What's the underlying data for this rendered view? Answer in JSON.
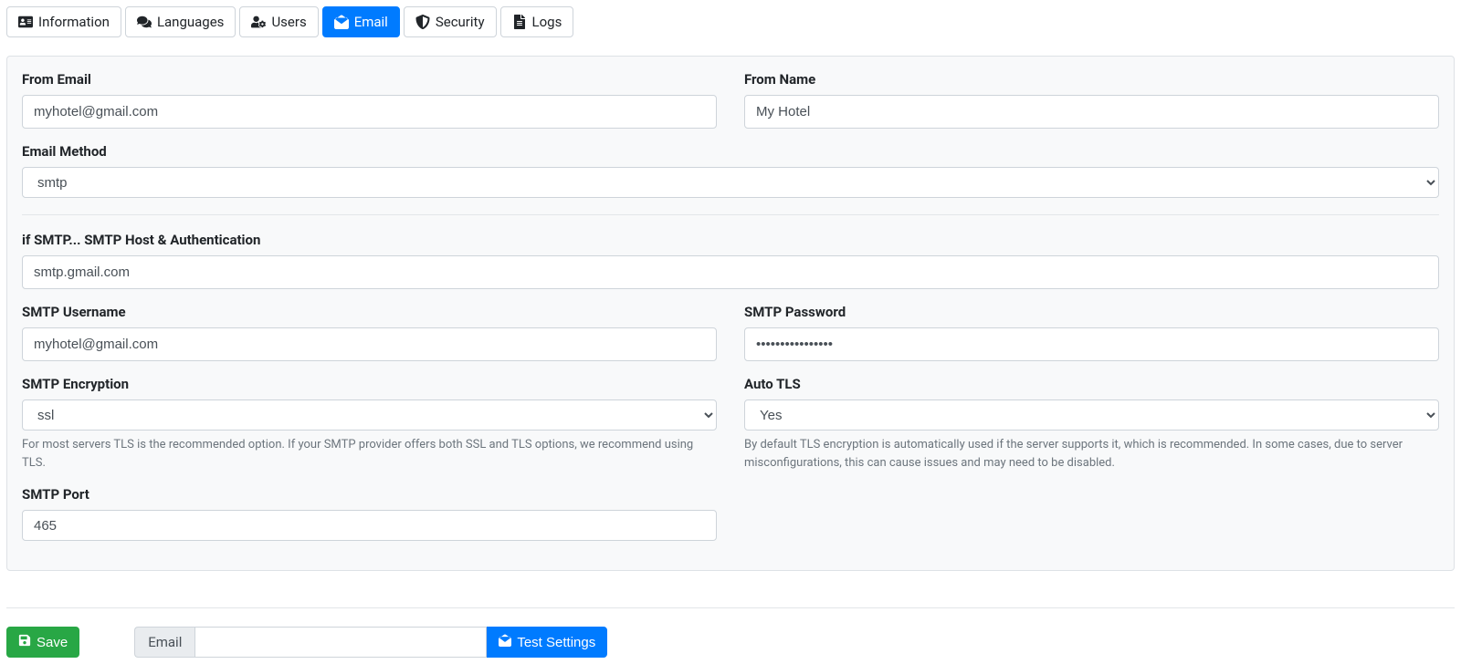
{
  "tabs": [
    {
      "name": "information",
      "label": "Information",
      "icon": "id-card-icon"
    },
    {
      "name": "languages",
      "label": "Languages",
      "icon": "comments-icon"
    },
    {
      "name": "users",
      "label": "Users",
      "icon": "user-gear-icon"
    },
    {
      "name": "email",
      "label": "Email",
      "icon": "envelope-open-icon",
      "active": true
    },
    {
      "name": "security",
      "label": "Security",
      "icon": "shield-icon"
    },
    {
      "name": "logs",
      "label": "Logs",
      "icon": "file-icon"
    }
  ],
  "form": {
    "from_email": {
      "label": "From Email",
      "value": "myhotel@gmail.com"
    },
    "from_name": {
      "label": "From Name",
      "value": "My Hotel"
    },
    "email_method": {
      "label": "Email Method",
      "value": "smtp"
    },
    "smtp_host": {
      "label": "if SMTP... SMTP Host & Authentication",
      "value": "smtp.gmail.com"
    },
    "smtp_user": {
      "label": "SMTP Username",
      "value": "myhotel@gmail.com"
    },
    "smtp_pass": {
      "label": "SMTP Password",
      "value": "••••••••••••••••"
    },
    "smtp_encryption": {
      "label": "SMTP Encryption",
      "value": "ssl",
      "help": "For most servers TLS is the recommended option. If your SMTP provider offers both SSL and TLS options, we recommend using TLS."
    },
    "auto_tls": {
      "label": "Auto TLS",
      "value": "Yes",
      "help": "By default TLS encryption is automatically used if the server supports it, which is recommended. In some cases, due to server misconfigurations, this can cause issues and may need to be disabled."
    },
    "smtp_port": {
      "label": "SMTP Port",
      "value": "465"
    }
  },
  "actions": {
    "save": "Save",
    "test_addon": "Email",
    "test_placeholder": "",
    "test_button": "Test Settings"
  }
}
